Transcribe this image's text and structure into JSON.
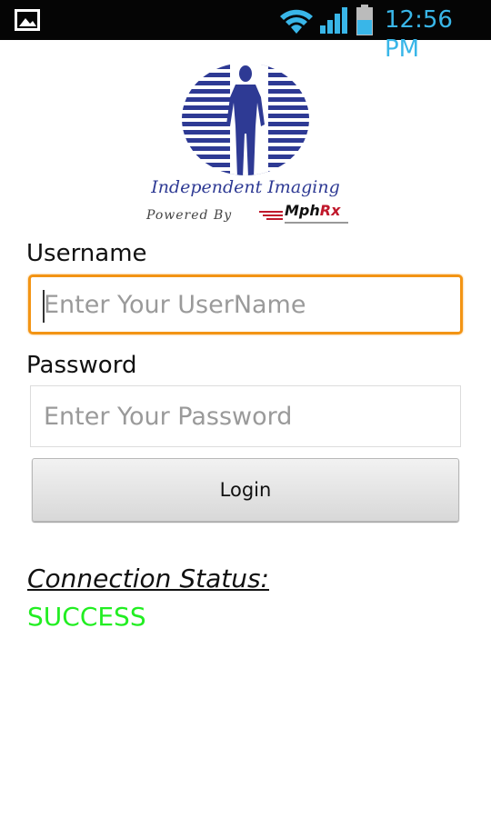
{
  "status_bar": {
    "time": "12:56 PM",
    "icons": [
      "gallery-icon",
      "wifi-icon",
      "signal-icon",
      "battery-icon"
    ],
    "time_color": "#39b6e8"
  },
  "logo": {
    "title": "Independent Imaging",
    "powered_by": "Powered By",
    "partner_brand": "MphRx",
    "brand_color": "#2e3a94"
  },
  "form": {
    "username_label": "Username",
    "username_placeholder": "Enter Your UserName",
    "password_label": "Password",
    "password_placeholder": "Enter Your Password",
    "login_label": "Login",
    "focus_color": "#f39414"
  },
  "connection": {
    "label": "Connection Status:",
    "value": "SUCCESS",
    "value_color": "#22ee22"
  }
}
